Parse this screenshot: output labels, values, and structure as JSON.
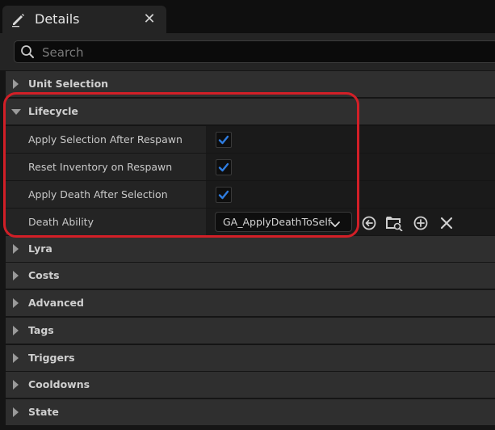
{
  "window": {
    "tab_title": "Details",
    "tab_icon": "pencil-icon",
    "close_glyph": "✕"
  },
  "search": {
    "placeholder": "Search",
    "value": ""
  },
  "categories": [
    {
      "label": "Unit Selection",
      "expanded": false
    },
    {
      "label": "Lifecycle",
      "expanded": true
    },
    {
      "label": "Lyra",
      "expanded": false
    },
    {
      "label": "Costs",
      "expanded": false
    },
    {
      "label": "Advanced",
      "expanded": false
    },
    {
      "label": "Tags",
      "expanded": false
    },
    {
      "label": "Triggers",
      "expanded": false
    },
    {
      "label": "Cooldowns",
      "expanded": false
    },
    {
      "label": "State",
      "expanded": false
    }
  ],
  "lifecycle": {
    "properties": [
      {
        "label": "Apply Selection After Respawn",
        "checked": true
      },
      {
        "label": "Reset Inventory on Respawn",
        "checked": true
      },
      {
        "label": "Apply Death After Selection",
        "checked": true
      }
    ],
    "death_ability": {
      "label": "Death Ability",
      "value": "GA_ApplyDeathToSelf",
      "actions": [
        "use-selected-icon",
        "browse-icon",
        "add-icon",
        "clear-icon"
      ]
    }
  },
  "colors": {
    "highlight": "#d21f27",
    "checkbox_check": "#2f7de1"
  }
}
